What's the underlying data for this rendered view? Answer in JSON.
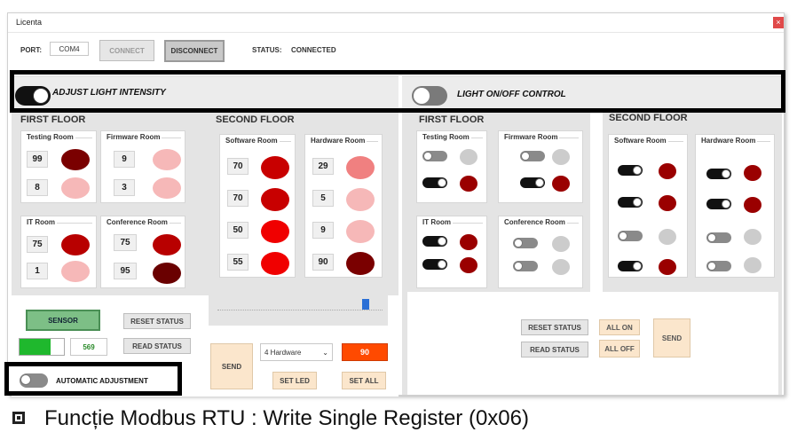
{
  "window": {
    "title": "Licenta",
    "close": "×"
  },
  "connection": {
    "port_label": "PORT:",
    "port_value": "COM4",
    "connect": "CONNECT",
    "disconnect": "DISCONNECT",
    "status_label": "STATUS:",
    "status_value": "CONNECTED"
  },
  "left_panel": {
    "title": "ADJUST LIGHT INTENSITY",
    "first_floor": {
      "title": "FIRST FLOOR",
      "rooms": [
        {
          "name": "Testing Room",
          "values": [
            "99",
            "8"
          ],
          "colors": [
            "#7a0000",
            "#f6b8b8"
          ]
        },
        {
          "name": "Firmware Room",
          "values": [
            "9",
            "3"
          ],
          "colors": [
            "#f6b8b8",
            "#f6b8b8"
          ]
        },
        {
          "name": "IT Room",
          "values": [
            "75",
            "1"
          ],
          "colors": [
            "#b80000",
            "#f6b8b8"
          ]
        },
        {
          "name": "Conference Room",
          "values": [
            "75",
            "95"
          ],
          "colors": [
            "#b80000",
            "#6a0000"
          ]
        }
      ]
    },
    "second_floor": {
      "title": "SECOND FLOOR",
      "rooms": [
        {
          "name": "Software Room",
          "values": [
            "70",
            "70",
            "50",
            "55"
          ],
          "colors": [
            "#c80000",
            "#c80000",
            "#f00000",
            "#f00000"
          ]
        },
        {
          "name": "Hardware Room",
          "values": [
            "29",
            "5",
            "9",
            "90"
          ],
          "colors": [
            "#f08080",
            "#f6b8b8",
            "#f6b8b8",
            "#7a0000"
          ]
        }
      ]
    },
    "sensor": "SENSOR",
    "reset_status": "RESET STATUS",
    "read_status": "READ STATUS",
    "sensor_value": "569",
    "sensor_level": 0.7,
    "slider_level": 0.9,
    "send": "SEND",
    "dropdown": "4 Hardware",
    "intensity_value": "90",
    "set_led": "SET LED",
    "set_all": "SET ALL",
    "auto_adjust": "AUTOMATIC ADJUSTMENT"
  },
  "right_panel": {
    "title": "LIGHT ON/OFF CONTROL",
    "first_floor": {
      "title": "FIRST FLOOR",
      "rooms": [
        "Testing Room",
        "Firmware Room",
        "IT Room",
        "Conference Room"
      ]
    },
    "second_floor": {
      "title": "SECOND FLOOR",
      "rooms": [
        "Software Room",
        "Hardware Room"
      ]
    },
    "reset_status": "RESET STATUS",
    "read_status": "READ STATUS",
    "all_on": "ALL ON",
    "all_off": "ALL OFF",
    "send": "SEND"
  },
  "colors": {
    "on_led": "#9a0000",
    "off_led": "#cccccc",
    "accent_orange": "#ff4a00",
    "sensor_green": "#1fb82d"
  },
  "caption": "Funcție Modbus RTU : Write Single Register (0x06)"
}
